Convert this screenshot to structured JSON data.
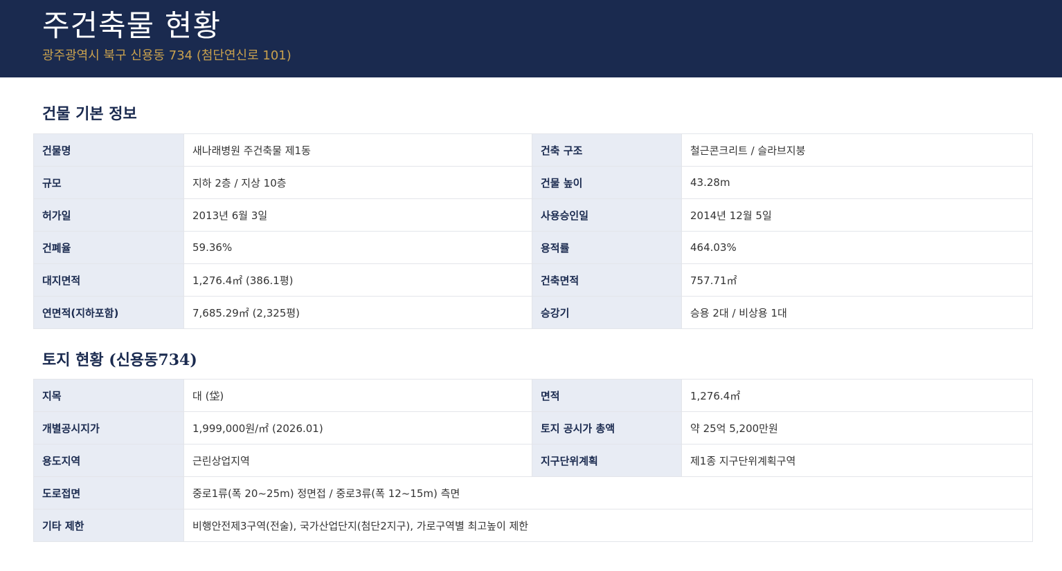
{
  "header": {
    "title": "주건축물 현황",
    "address": "광주광역시 북구 신용동 734 (첨단연신로 101)"
  },
  "building": {
    "title": "건물 기본 정보",
    "rows": [
      [
        "건물명",
        "새나래병원 주건축물 제1동",
        "건축 구조",
        "철근콘크리트 / 슬라브지붕"
      ],
      [
        "규모",
        "지하 2층 / 지상 10층",
        "건물 높이",
        "43.28m"
      ],
      [
        "허가일",
        "2013년 6월 3일",
        "사용승인일",
        "2014년 12월 5일"
      ],
      [
        "건폐율",
        "59.36%",
        "용적률",
        "464.03%"
      ],
      [
        "대지면적",
        "1,276.4㎡ (386.1평)",
        "건축면적",
        "757.71㎡"
      ],
      [
        "연면적(지하포함)",
        "7,685.29㎡ (2,325평)",
        "승강기",
        "승용 2대 / 비상용 1대"
      ]
    ]
  },
  "land": {
    "title": "토지 현황 (신용동734)",
    "rows": [
      [
        "지목",
        "대 (垈)",
        "면적",
        "1,276.4㎡"
      ],
      [
        "개별공시지가",
        "1,999,000원/㎡ (2026.01)",
        "토지 공시가 총액",
        "약 25억 5,200만원"
      ],
      [
        "용도지역",
        "근린상업지역",
        "지구단위계획",
        "제1종 지구단위계획구역"
      ]
    ],
    "wide_rows": [
      [
        "도로접면",
        "중로1류(폭 20~25m) 정면접 / 중로3류(폭 12~15m) 측면"
      ],
      [
        "기타 제한",
        "비행안전제3구역(전술), 국가산업단지(첨단2지구), 가로구역별 최고높이 제한"
      ]
    ]
  }
}
